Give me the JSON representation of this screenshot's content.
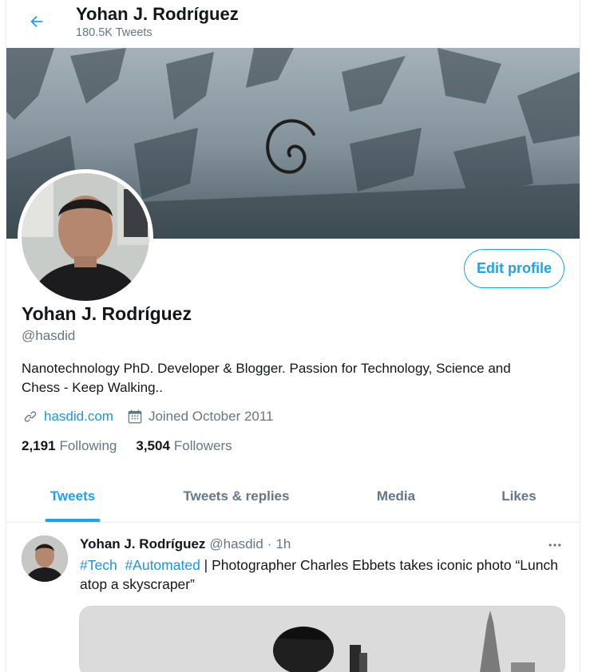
{
  "header": {
    "name": "Yohan J. Rodríguez",
    "tweet_count": "180.5K Tweets",
    "back_icon": "arrow-left-icon"
  },
  "profile": {
    "name": "Yohan J. Rodríguez",
    "handle": "@hasdid",
    "edit_label": "Edit profile",
    "bio": "Nanotechnology PhD. Developer & Blogger. Passion for Technology, Science and Chess - Keep Walking..",
    "website": "hasdid.com",
    "joined": "Joined October 2011",
    "following_count": "2,191",
    "following_label": "Following",
    "followers_count": "3,504",
    "followers_label": "Followers"
  },
  "tabs": [
    {
      "label": "Tweets",
      "active": true
    },
    {
      "label": "Tweets & replies",
      "active": false
    },
    {
      "label": "Media",
      "active": false
    },
    {
      "label": "Likes",
      "active": false
    }
  ],
  "tweet": {
    "name": "Yohan J. Rodríguez",
    "handle": "@hasdid",
    "dot": "·",
    "time": "1h",
    "hashtag1": "#Tech",
    "hashtag2": "#Automated",
    "text": " | Photographer Charles Ebbets takes iconic photo “Lunch atop a skyscraper”"
  },
  "colors": {
    "accent": "#1da1f2",
    "link": "#1b95e0",
    "secondary_text": "#657786",
    "primary_text": "#14171a",
    "border": "#e6ecf0"
  }
}
